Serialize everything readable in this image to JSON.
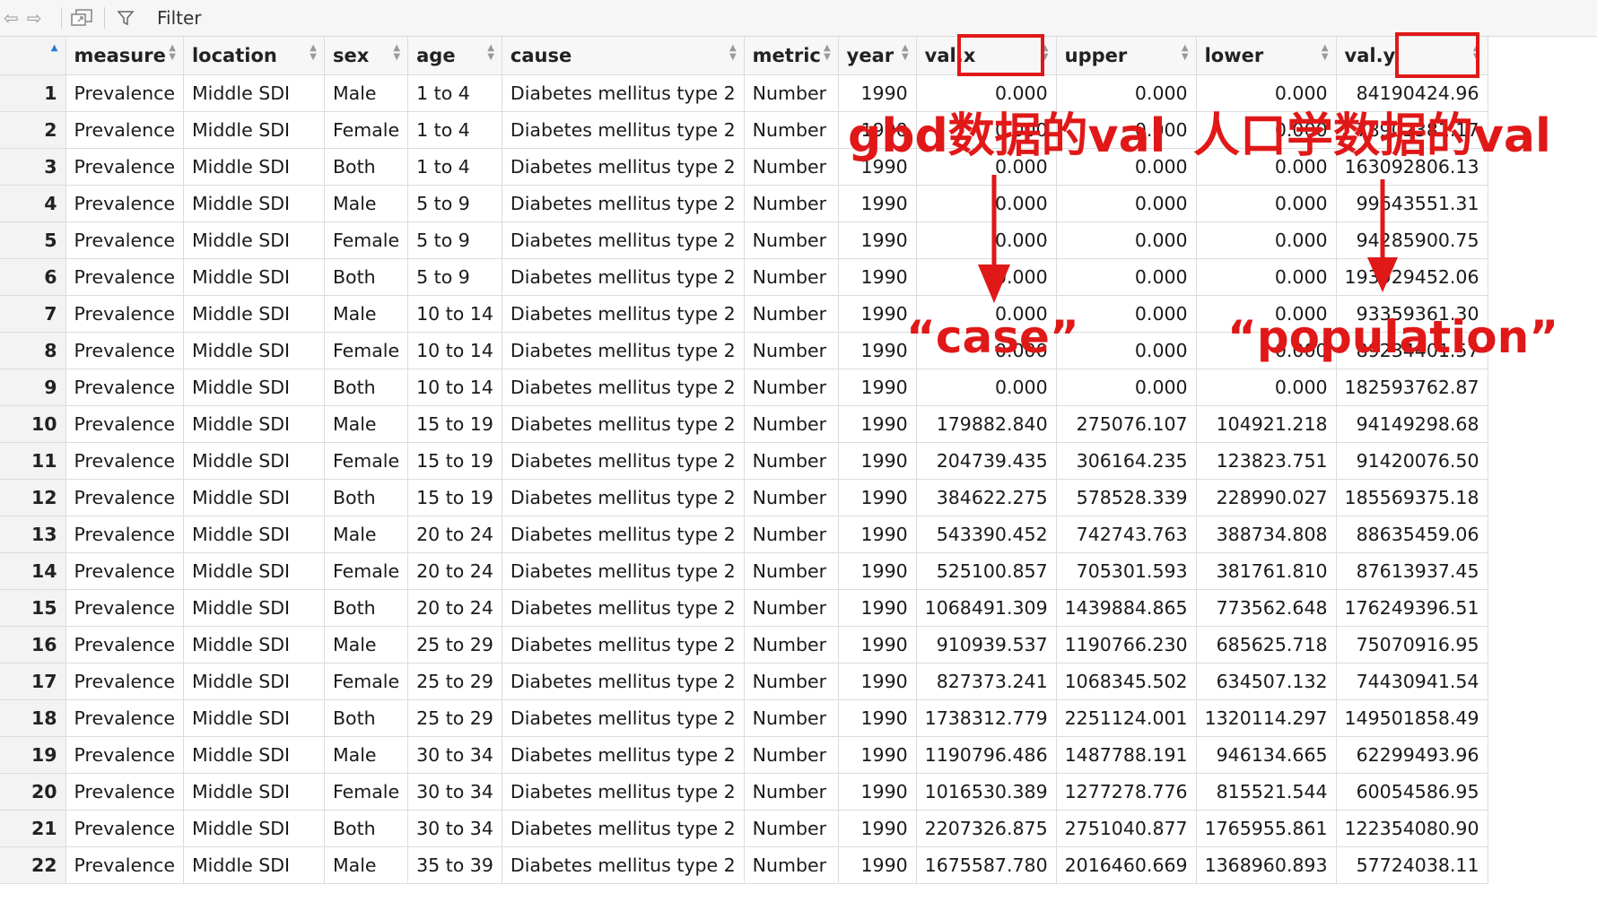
{
  "toolbar": {
    "filter_label": "Filter"
  },
  "columns": [
    "",
    "measure",
    "location",
    "sex",
    "age",
    "cause",
    "metric",
    "year",
    "val.x",
    "upper",
    "lower",
    "val.y"
  ],
  "rows": [
    [
      "1",
      "Prevalence",
      "Middle SDI",
      "Male",
      "1 to 4",
      "Diabetes mellitus type 2",
      "Number",
      "1990",
      "0.000",
      "0.000",
      "0.000",
      "84190424.96"
    ],
    [
      "2",
      "Prevalence",
      "Middle SDI",
      "Female",
      "1 to 4",
      "Diabetes mellitus type 2",
      "Number",
      "1990",
      "0.000",
      "0.000",
      "0.000",
      "78902381.17"
    ],
    [
      "3",
      "Prevalence",
      "Middle SDI",
      "Both",
      "1 to 4",
      "Diabetes mellitus type 2",
      "Number",
      "1990",
      "0.000",
      "0.000",
      "0.000",
      "163092806.13"
    ],
    [
      "4",
      "Prevalence",
      "Middle SDI",
      "Male",
      "5 to 9",
      "Diabetes mellitus type 2",
      "Number",
      "1990",
      "0.000",
      "0.000",
      "0.000",
      "99643551.31"
    ],
    [
      "5",
      "Prevalence",
      "Middle SDI",
      "Female",
      "5 to 9",
      "Diabetes mellitus type 2",
      "Number",
      "1990",
      "0.000",
      "0.000",
      "0.000",
      "94285900.75"
    ],
    [
      "6",
      "Prevalence",
      "Middle SDI",
      "Both",
      "5 to 9",
      "Diabetes mellitus type 2",
      "Number",
      "1990",
      "0.000",
      "0.000",
      "0.000",
      "193929452.06"
    ],
    [
      "7",
      "Prevalence",
      "Middle SDI",
      "Male",
      "10 to 14",
      "Diabetes mellitus type 2",
      "Number",
      "1990",
      "0.000",
      "0.000",
      "0.000",
      "93359361.30"
    ],
    [
      "8",
      "Prevalence",
      "Middle SDI",
      "Female",
      "10 to 14",
      "Diabetes mellitus type 2",
      "Number",
      "1990",
      "0.000",
      "0.000",
      "0.000",
      "89234401.57"
    ],
    [
      "9",
      "Prevalence",
      "Middle SDI",
      "Both",
      "10 to 14",
      "Diabetes mellitus type 2",
      "Number",
      "1990",
      "0.000",
      "0.000",
      "0.000",
      "182593762.87"
    ],
    [
      "10",
      "Prevalence",
      "Middle SDI",
      "Male",
      "15 to 19",
      "Diabetes mellitus type 2",
      "Number",
      "1990",
      "179882.840",
      "275076.107",
      "104921.218",
      "94149298.68"
    ],
    [
      "11",
      "Prevalence",
      "Middle SDI",
      "Female",
      "15 to 19",
      "Diabetes mellitus type 2",
      "Number",
      "1990",
      "204739.435",
      "306164.235",
      "123823.751",
      "91420076.50"
    ],
    [
      "12",
      "Prevalence",
      "Middle SDI",
      "Both",
      "15 to 19",
      "Diabetes mellitus type 2",
      "Number",
      "1990",
      "384622.275",
      "578528.339",
      "228990.027",
      "185569375.18"
    ],
    [
      "13",
      "Prevalence",
      "Middle SDI",
      "Male",
      "20 to 24",
      "Diabetes mellitus type 2",
      "Number",
      "1990",
      "543390.452",
      "742743.763",
      "388734.808",
      "88635459.06"
    ],
    [
      "14",
      "Prevalence",
      "Middle SDI",
      "Female",
      "20 to 24",
      "Diabetes mellitus type 2",
      "Number",
      "1990",
      "525100.857",
      "705301.593",
      "381761.810",
      "87613937.45"
    ],
    [
      "15",
      "Prevalence",
      "Middle SDI",
      "Both",
      "20 to 24",
      "Diabetes mellitus type 2",
      "Number",
      "1990",
      "1068491.309",
      "1439884.865",
      "773562.648",
      "176249396.51"
    ],
    [
      "16",
      "Prevalence",
      "Middle SDI",
      "Male",
      "25 to 29",
      "Diabetes mellitus type 2",
      "Number",
      "1990",
      "910939.537",
      "1190766.230",
      "685625.718",
      "75070916.95"
    ],
    [
      "17",
      "Prevalence",
      "Middle SDI",
      "Female",
      "25 to 29",
      "Diabetes mellitus type 2",
      "Number",
      "1990",
      "827373.241",
      "1068345.502",
      "634507.132",
      "74430941.54"
    ],
    [
      "18",
      "Prevalence",
      "Middle SDI",
      "Both",
      "25 to 29",
      "Diabetes mellitus type 2",
      "Number",
      "1990",
      "1738312.779",
      "2251124.001",
      "1320114.297",
      "149501858.49"
    ],
    [
      "19",
      "Prevalence",
      "Middle SDI",
      "Male",
      "30 to 34",
      "Diabetes mellitus type 2",
      "Number",
      "1990",
      "1190796.486",
      "1487788.191",
      "946134.665",
      "62299493.96"
    ],
    [
      "20",
      "Prevalence",
      "Middle SDI",
      "Female",
      "30 to 34",
      "Diabetes mellitus type 2",
      "Number",
      "1990",
      "1016530.389",
      "1277278.776",
      "815521.544",
      "60054586.95"
    ],
    [
      "21",
      "Prevalence",
      "Middle SDI",
      "Both",
      "30 to 34",
      "Diabetes mellitus type 2",
      "Number",
      "1990",
      "2207326.875",
      "2751040.877",
      "1765955.861",
      "122354080.90"
    ],
    [
      "22",
      "Prevalence",
      "Middle SDI",
      "Male",
      "35 to 39",
      "Diabetes mellitus type 2",
      "Number",
      "1990",
      "1675587.780",
      "2016460.669",
      "1368960.893",
      "57724038.11"
    ]
  ],
  "annotations": {
    "gbd_label": "gbd数据的val",
    "pop_label": "人口学数据的val",
    "case_label": "“case”",
    "population_label": "“population”"
  },
  "colors": {
    "annotation_red": "#e01818",
    "sort_active": "#2a7bd8"
  }
}
